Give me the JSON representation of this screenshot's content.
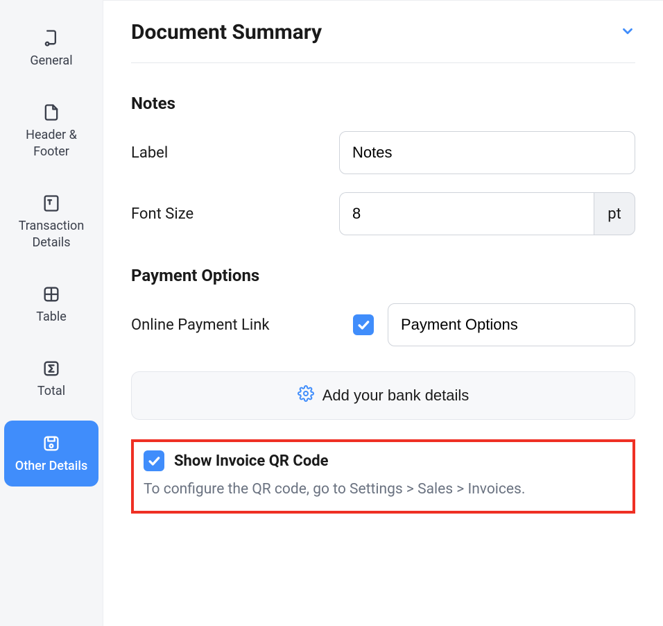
{
  "sidebar": {
    "items": [
      {
        "label": "General"
      },
      {
        "label": "Header & Footer"
      },
      {
        "label": "Transaction Details"
      },
      {
        "label": "Table"
      },
      {
        "label": "Total"
      },
      {
        "label": "Other Details"
      }
    ]
  },
  "main": {
    "accordion_title": "Document Summary",
    "notes": {
      "heading": "Notes",
      "label_field": "Label",
      "label_value": "Notes",
      "fontsize_label": "Font Size",
      "fontsize_value": "8",
      "fontsize_unit": "pt"
    },
    "payment": {
      "heading": "Payment Options",
      "link_label": "Online Payment Link",
      "link_checked": true,
      "link_value": "Payment Options",
      "bank_button": "Add your bank details"
    },
    "qr": {
      "checked": true,
      "title": "Show Invoice QR Code",
      "help": "To configure the QR code, go to Settings > Sales > Invoices."
    }
  }
}
